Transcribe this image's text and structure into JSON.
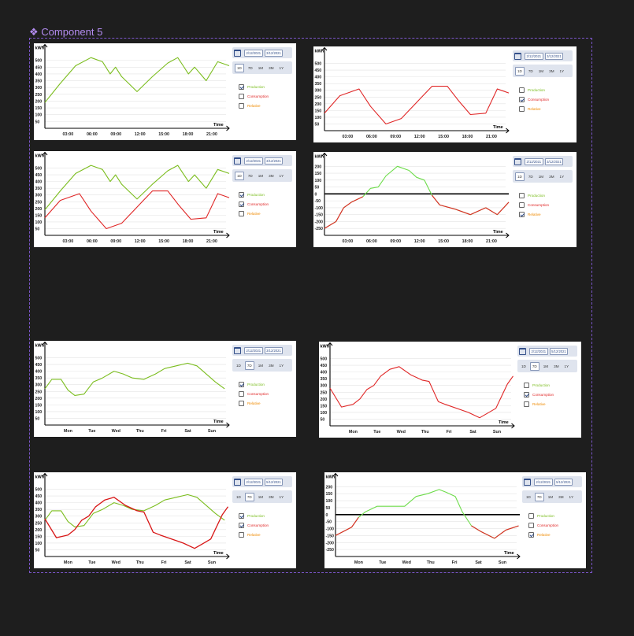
{
  "component": {
    "title": "Component 5"
  },
  "colors": {
    "production": "#7bbd1e",
    "production_light": "#6ddc4a",
    "consumption": "#e02626",
    "consumption_dark": "#d81616",
    "relative": "#ef8a00",
    "accent": "#34508a"
  },
  "controls": {
    "date_start_a": "2/12/2021",
    "date_end_a": "3/12/2021",
    "date_start_b": "2/12/2021",
    "date_end_b": "3/12/2021",
    "date_start_c": "2/12/2021",
    "date_end_c": "5/12/2021",
    "date_start_d": "2/12/2021",
    "date_end_d": "5/12/2021",
    "periods": [
      "1D",
      "7D",
      "1M",
      "3M",
      "1Y"
    ],
    "legend": [
      "Production",
      "Consumption",
      "Relative"
    ]
  },
  "axis": {
    "y_unit": "kWh",
    "x_title": "Time"
  },
  "chart_data": [
    {
      "id": "day-production",
      "type": "line",
      "x_ticks": [
        "03:00",
        "06:00",
        "09:00",
        "12:00",
        "15:00",
        "18:00",
        "21:00"
      ],
      "y_ticks": [
        50,
        100,
        150,
        200,
        250,
        300,
        350,
        400,
        450,
        500
      ],
      "ylim": [
        0,
        550
      ],
      "xlim": [
        0,
        24
      ],
      "active_period": "1D",
      "checked": [
        "Production"
      ],
      "series": [
        {
          "name": "Production",
          "color": "production",
          "x": [
            0,
            2,
            4,
            6,
            7.5,
            8.5,
            9.2,
            10,
            12,
            14,
            16,
            17.3,
            18,
            18.7,
            19.5,
            21,
            22.5,
            24
          ],
          "y": [
            190,
            330,
            460,
            520,
            490,
            400,
            450,
            380,
            270,
            380,
            480,
            520,
            460,
            400,
            450,
            350,
            490,
            460
          ]
        }
      ]
    },
    {
      "id": "day-consumption",
      "type": "line",
      "x_ticks": [
        "03:00",
        "06:00",
        "09:00",
        "12:00",
        "15:00",
        "18:00",
        "21:00"
      ],
      "y_ticks": [
        50,
        100,
        150,
        200,
        250,
        300,
        350,
        400,
        450,
        500
      ],
      "ylim": [
        0,
        550
      ],
      "xlim": [
        0,
        24
      ],
      "active_period": "1D",
      "checked": [
        "Consumption"
      ],
      "series": [
        {
          "name": "Consumption",
          "color": "consumption",
          "x": [
            0,
            2,
            4.5,
            6,
            8,
            10,
            14,
            16,
            17.5,
            19,
            21,
            22.5,
            24
          ],
          "y": [
            130,
            260,
            310,
            180,
            50,
            90,
            330,
            330,
            220,
            120,
            130,
            310,
            280
          ]
        }
      ]
    },
    {
      "id": "day-both",
      "type": "line",
      "x_ticks": [
        "03:00",
        "06:00",
        "09:00",
        "12:00",
        "15:00",
        "18:00",
        "21:00"
      ],
      "y_ticks": [
        50,
        100,
        150,
        200,
        250,
        300,
        350,
        400,
        450,
        500
      ],
      "ylim": [
        0,
        550
      ],
      "xlim": [
        0,
        24
      ],
      "active_period": "1D",
      "checked": [
        "Production",
        "Consumption"
      ],
      "series": [
        {
          "name": "Production",
          "color": "production",
          "x": [
            0,
            2,
            4,
            6,
            7.5,
            8.5,
            9.2,
            10,
            12,
            14,
            16,
            17.3,
            18,
            18.7,
            19.5,
            21,
            22.5,
            24
          ],
          "y": [
            190,
            330,
            460,
            520,
            490,
            400,
            450,
            380,
            270,
            380,
            480,
            520,
            460,
            400,
            450,
            350,
            490,
            460
          ]
        },
        {
          "name": "Consumption",
          "color": "consumption",
          "x": [
            0,
            2,
            4.5,
            6,
            8,
            10,
            14,
            16,
            17.5,
            19,
            21,
            22.5,
            24
          ],
          "y": [
            130,
            260,
            310,
            180,
            50,
            90,
            330,
            330,
            220,
            120,
            130,
            310,
            280
          ]
        }
      ]
    },
    {
      "id": "day-relative",
      "type": "line",
      "x_ticks": [
        "03:00",
        "06:00",
        "09:00",
        "12:00",
        "15:00",
        "18:00",
        "21:00"
      ],
      "y_ticks": [
        -250,
        -200,
        -150,
        -100,
        -50,
        0,
        50,
        100,
        150,
        200
      ],
      "ylim": [
        -300,
        230
      ],
      "xlim": [
        0,
        24
      ],
      "active_period": "1D",
      "checked": [
        "Relative"
      ],
      "series": [
        {
          "name": "Relative",
          "color": "production_light",
          "x": [
            0,
            1.5,
            2.5,
            3.5,
            5,
            6,
            7,
            8,
            9.5,
            11,
            12,
            13,
            14,
            15,
            17,
            19,
            21,
            22.5,
            24
          ],
          "y": [
            -250,
            -200,
            -100,
            -60,
            -20,
            40,
            50,
            130,
            200,
            170,
            120,
            100,
            -10,
            -80,
            -110,
            -150,
            -100,
            -150,
            -60
          ]
        }
      ]
    },
    {
      "id": "week-production",
      "type": "line",
      "x_ticks": [
        "Mon",
        "Tue",
        "Wed",
        "Thu",
        "Fri",
        "Sat",
        "Sun"
      ],
      "y_ticks": [
        50,
        100,
        150,
        200,
        250,
        300,
        350,
        400,
        450,
        500
      ],
      "ylim": [
        0,
        550
      ],
      "xlim": [
        0,
        8
      ],
      "active_period": "7D",
      "checked": [
        "Production"
      ],
      "series": [
        {
          "name": "Production",
          "color": "production",
          "x": [
            0,
            0.3,
            0.7,
            1,
            1.3,
            1.7,
            2.1,
            2.5,
            3,
            3.4,
            3.8,
            4.3,
            4.8,
            5.2,
            5.7,
            6.2,
            6.6,
            7,
            7.4,
            7.8
          ],
          "y": [
            270,
            340,
            340,
            260,
            220,
            230,
            320,
            350,
            400,
            380,
            350,
            340,
            380,
            420,
            440,
            460,
            440,
            380,
            320,
            270
          ]
        }
      ]
    },
    {
      "id": "week-consumption",
      "type": "line",
      "x_ticks": [
        "Mon",
        "Tue",
        "Wed",
        "Thu",
        "Fri",
        "Sat",
        "Sun"
      ],
      "y_ticks": [
        50,
        100,
        150,
        200,
        250,
        300,
        350,
        400,
        450,
        500
      ],
      "ylim": [
        0,
        550
      ],
      "xlim": [
        0,
        8
      ],
      "active_period": "7D",
      "checked": [
        "Consumption"
      ],
      "series": [
        {
          "name": "Consumption",
          "color": "consumption",
          "x": [
            0,
            0.5,
            1,
            1.3,
            1.6,
            1.9,
            2.2,
            2.6,
            3,
            3.5,
            4,
            4.3,
            4.7,
            5,
            6,
            6.5,
            7.2,
            7.7,
            7.95
          ],
          "y": [
            280,
            140,
            160,
            200,
            270,
            300,
            370,
            420,
            440,
            380,
            340,
            330,
            180,
            160,
            100,
            60,
            130,
            310,
            370
          ]
        }
      ]
    },
    {
      "id": "week-both",
      "type": "line",
      "x_ticks": [
        "Mon",
        "Tue",
        "Wed",
        "Thu",
        "Fri",
        "Sat",
        "Sun"
      ],
      "y_ticks": [
        50,
        100,
        150,
        200,
        250,
        300,
        350,
        400,
        450,
        500
      ],
      "ylim": [
        0,
        550
      ],
      "xlim": [
        0,
        8
      ],
      "active_period": "7D",
      "checked": [
        "Production",
        "Consumption"
      ],
      "series": [
        {
          "name": "Production",
          "color": "production",
          "x": [
            0,
            0.3,
            0.7,
            1,
            1.3,
            1.7,
            2.1,
            2.5,
            3,
            3.4,
            3.8,
            4.3,
            4.8,
            5.2,
            5.7,
            6.2,
            6.6,
            7,
            7.4,
            7.8
          ],
          "y": [
            270,
            340,
            340,
            260,
            220,
            230,
            320,
            350,
            400,
            380,
            350,
            340,
            380,
            420,
            440,
            460,
            440,
            380,
            320,
            270
          ]
        },
        {
          "name": "Consumption",
          "color": "consumption_dark",
          "x": [
            0,
            0.5,
            1,
            1.3,
            1.6,
            1.9,
            2.2,
            2.6,
            3,
            3.5,
            4,
            4.3,
            4.7,
            5,
            6,
            6.5,
            7.2,
            7.7,
            7.95
          ],
          "y": [
            280,
            140,
            160,
            200,
            270,
            300,
            370,
            420,
            440,
            380,
            340,
            330,
            180,
            160,
            100,
            60,
            130,
            310,
            370
          ]
        }
      ]
    },
    {
      "id": "week-relative",
      "type": "line",
      "x_ticks": [
        "Mon",
        "Tue",
        "Wed",
        "Thu",
        "Fri",
        "Sat",
        "Sun"
      ],
      "y_ticks": [
        -250,
        -200,
        -150,
        -100,
        -50,
        0,
        50,
        100,
        150,
        200
      ],
      "ylim": [
        -300,
        230
      ],
      "xlim": [
        0,
        8
      ],
      "active_period": "7D",
      "checked": [
        "Relative"
      ],
      "series": [
        {
          "name": "Relative",
          "color": "production_light",
          "x": [
            0,
            0.7,
            1,
            1.3,
            1.8,
            2.3,
            3,
            3.5,
            4,
            4.5,
            4.8,
            5.2,
            5.5,
            5.9,
            6.3,
            6.9,
            7.4,
            7.95
          ],
          "y": [
            -150,
            -90,
            -20,
            20,
            60,
            60,
            60,
            130,
            150,
            180,
            160,
            130,
            20,
            -80,
            -120,
            -170,
            -110,
            -80
          ]
        }
      ]
    }
  ]
}
